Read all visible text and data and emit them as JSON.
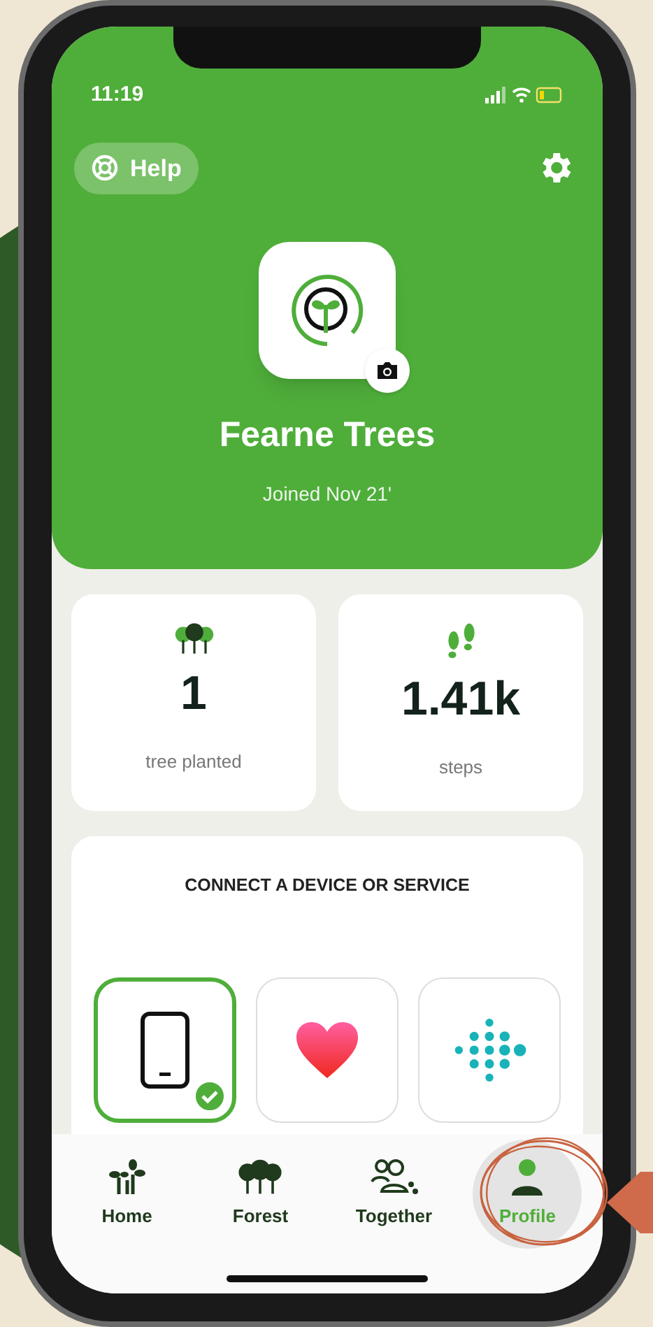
{
  "status_bar": {
    "time": "11:19"
  },
  "header": {
    "help_label": "Help",
    "name": "Fearne Trees",
    "joined": "Joined Nov 21'"
  },
  "stats": [
    {
      "kind": "trees",
      "value": "1",
      "label": "tree planted"
    },
    {
      "kind": "steps",
      "value": "1.41k",
      "label": "steps"
    }
  ],
  "connect": {
    "title": "CONNECT A DEVICE OR SERVICE",
    "devices": [
      {
        "kind": "phone",
        "connected": true
      },
      {
        "kind": "health",
        "connected": false
      },
      {
        "kind": "fitbit",
        "connected": false
      }
    ]
  },
  "tab_bar": [
    {
      "kind": "home",
      "label": "Home",
      "selected": false
    },
    {
      "kind": "forest",
      "label": "Forest",
      "selected": false
    },
    {
      "kind": "together",
      "label": "Together",
      "selected": false
    },
    {
      "kind": "profile",
      "label": "Profile",
      "selected": true
    }
  ]
}
